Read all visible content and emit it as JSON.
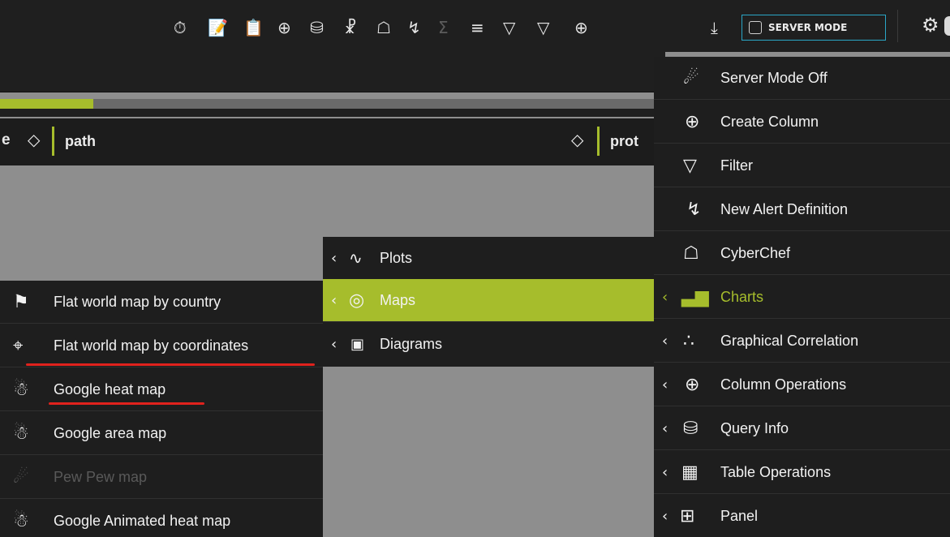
{
  "toolbar": {
    "icons": [
      "timer-list-icon",
      "edit-pages-icon",
      "clipboard-icon",
      "add-column-icon",
      "database-edit-icon",
      "network-icon",
      "chef-hat-icon",
      "lightning-icon",
      "sum-icon",
      "layers-icon",
      "filter-or-icon",
      "filter-icon",
      "add-column-2-icon",
      "download-icon"
    ],
    "server_mode_label": "SERVER MODE",
    "server_mode_checked": false
  },
  "progress": {
    "fraction": 0.14,
    "color": "#a6bd2c"
  },
  "table": {
    "partial_column_suffix": "e",
    "columns": [
      {
        "label": "path"
      },
      {
        "label": "prot"
      }
    ]
  },
  "right_menu": {
    "items": [
      {
        "label": "Server Mode Off",
        "icon": "server-off-icon"
      },
      {
        "label": "Create Column",
        "icon": "add-column-icon"
      },
      {
        "label": "Filter",
        "icon": "filter-icon"
      },
      {
        "label": "New Alert Definition",
        "icon": "lightning-icon"
      },
      {
        "label": "CyberChef",
        "icon": "chef-hat-icon"
      },
      {
        "label": "Charts",
        "icon": "bar-chart-icon",
        "submenu": true,
        "active": true
      },
      {
        "label": "Graphical Correlation",
        "icon": "scatter-icon",
        "submenu": true
      },
      {
        "label": "Column Operations",
        "icon": "column-ops-icon",
        "submenu": true
      },
      {
        "label": "Query Info",
        "icon": "database-info-icon",
        "submenu": true
      },
      {
        "label": "Table Operations",
        "icon": "table-gear-icon",
        "submenu": true
      },
      {
        "label": "Panel",
        "icon": "panel-icon",
        "submenu": true
      }
    ]
  },
  "charts_menu": {
    "items": [
      {
        "label": "Plots",
        "icon": "line-plot-icon"
      },
      {
        "label": "Maps",
        "icon": "globe-icon",
        "active": true
      },
      {
        "label": "Diagrams",
        "icon": "diagram-icon"
      }
    ]
  },
  "maps_menu": {
    "items": [
      {
        "label": "Flat world map by country",
        "icon": "flag-globe-icon"
      },
      {
        "label": "Flat world map by coordinates",
        "icon": "pin-globe-icon",
        "underlined": true
      },
      {
        "label": "Google heat map",
        "icon": "heat-globe-icon",
        "underlined": true
      },
      {
        "label": "Google area map",
        "icon": "area-globe-icon"
      },
      {
        "label": "Pew Pew map",
        "icon": "pewpew-icon",
        "disabled": true
      },
      {
        "label": "Google Animated heat map",
        "icon": "animated-globe-icon"
      }
    ]
  }
}
